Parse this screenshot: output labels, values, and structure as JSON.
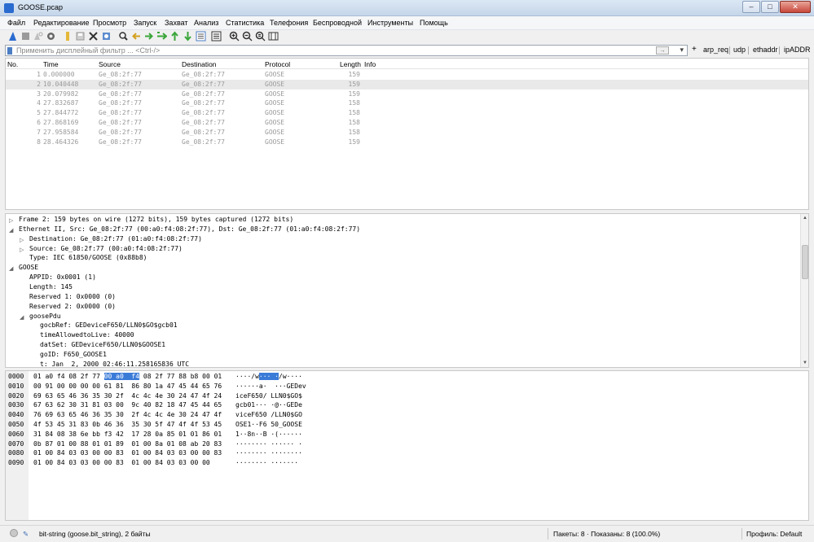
{
  "window": {
    "title": "GOOSE.pcap",
    "min": "–",
    "max": "□",
    "close": "✕"
  },
  "menu": [
    "Файл",
    "Редактирование",
    "Просмотр",
    "Запуск",
    "Захват",
    "Анализ",
    "Статистика",
    "Телефония",
    "Беспроводной",
    "Инструменты",
    "Помощь"
  ],
  "toolbar_icons": [
    "shark-fin-start-icon",
    "stop-icon",
    "restart-icon",
    "options-gear-icon",
    "open-folder-icon",
    "save-icon",
    "close-file-icon",
    "reload-icon",
    "find-icon",
    "back-arrow-icon",
    "forward-arrow-icon",
    "go-to-packet-icon",
    "first-packet-icon",
    "last-packet-icon",
    "autoscroll-icon",
    "colorize-icon",
    "zoom-in-icon",
    "zoom-out-icon",
    "zoom-normal-icon",
    "resize-columns-icon"
  ],
  "filter": {
    "placeholder": "Применить дисплейный фильтр ... <Ctrl-/>",
    "arrow": "→",
    "dropdown": "▾",
    "apply": "→",
    "plus": "+",
    "buttons": [
      "arp_req",
      "udp",
      "ethaddr",
      "ipADDR"
    ]
  },
  "packet_list": {
    "columns": [
      "No.",
      "Time",
      "Source",
      "Destination",
      "Protocol",
      "Length",
      "Info"
    ],
    "rows": [
      {
        "no": "1",
        "time": "0.000000",
        "src": "Ge_08:2f:77",
        "dst": "Ge_08:2f:77",
        "proto": "GOOSE",
        "len": "159"
      },
      {
        "no": "2",
        "time": "10.040448",
        "src": "Ge_08:2f:77",
        "dst": "Ge_08:2f:77",
        "proto": "GOOSE",
        "len": "159"
      },
      {
        "no": "3",
        "time": "20.079982",
        "src": "Ge_08:2f:77",
        "dst": "Ge_08:2f:77",
        "proto": "GOOSE",
        "len": "159"
      },
      {
        "no": "4",
        "time": "27.832687",
        "src": "Ge_08:2f:77",
        "dst": "Ge_08:2f:77",
        "proto": "GOOSE",
        "len": "158"
      },
      {
        "no": "5",
        "time": "27.844772",
        "src": "Ge_08:2f:77",
        "dst": "Ge_08:2f:77",
        "proto": "GOOSE",
        "len": "158"
      },
      {
        "no": "6",
        "time": "27.868169",
        "src": "Ge_08:2f:77",
        "dst": "Ge_08:2f:77",
        "proto": "GOOSE",
        "len": "158"
      },
      {
        "no": "7",
        "time": "27.958584",
        "src": "Ge_08:2f:77",
        "dst": "Ge_08:2f:77",
        "proto": "GOOSE",
        "len": "158"
      },
      {
        "no": "8",
        "time": "28.464326",
        "src": "Ge_08:2f:77",
        "dst": "Ge_08:2f:77",
        "proto": "GOOSE",
        "len": "159"
      }
    ]
  },
  "details": [
    {
      "text": "Frame 2: 159 bytes on wire (1272 bits), 159 bytes captured (1272 bits)",
      "tri": "▷"
    },
    {
      "text": "Ethernet II, Src: Ge_08:2f:77 (00:a0:f4:08:2f:77), Dst: Ge_08:2f:77 (01:a0:f4:08:2f:77)",
      "tri": "◢"
    },
    {
      "text": "Destination: Ge_08:2f:77 (01:a0:f4:08:2f:77)",
      "tri": "▷"
    },
    {
      "text": "Source: Ge_08:2f:77 (00:a0:f4:08:2f:77)",
      "tri": "▷"
    },
    {
      "text": "Type: IEC 61850/GOOSE (0x88b8)",
      "tri": ""
    },
    {
      "text": "GOOSE",
      "tri": "◢"
    },
    {
      "text": "APPID: 0x0001 (1)",
      "tri": ""
    },
    {
      "text": "Length: 145",
      "tri": ""
    },
    {
      "text": "Reserved 1: 0x0000 (0)",
      "tri": ""
    },
    {
      "text": "Reserved 2: 0x0000 (0)",
      "tri": ""
    },
    {
      "text": "goosePdu",
      "tri": "◢"
    },
    {
      "text": "gocbRef: GEDeviceF650/LLN0$GO$gcb01",
      "tri": ""
    },
    {
      "text": "timeAllowedtoLive: 40000",
      "tri": ""
    },
    {
      "text": "datSet: GEDeviceF650/LLN0$GOOSE1",
      "tri": ""
    },
    {
      "text": "goID: F650_GOOSE1",
      "tri": ""
    },
    {
      "text": "t: Jan  2, 2000 02:46:11.258165836 UTC",
      "tri": ""
    }
  ],
  "hex": [
    {
      "off": "0000",
      "h1": "01 a0 f4 08 2f 77",
      "hl": "00 a0  f4",
      "h2": "08 2f 77 88 b8 00 01",
      "a1": "····/w",
      "ahl": "··· ·",
      "a2": "/w····"
    },
    {
      "off": "0010",
      "h1": "00 91 00 00 00 00 61 81  86 80 1a 47 45 44 65 76",
      "hl": "",
      "h2": "",
      "a1": "······a·  ···GEDev",
      "ahl": "",
      "a2": ""
    },
    {
      "off": "0020",
      "h1": "69 63 65 46 36 35 30 2f  4c 4c 4e 30 24 47 4f 24",
      "hl": "",
      "h2": "",
      "a1": "iceF650/ LLN0$GO$",
      "ahl": "",
      "a2": ""
    },
    {
      "off": "0030",
      "h1": "67 63 62 30 31 81 03 00  9c 40 82 18 47 45 44 65",
      "hl": "",
      "h2": "",
      "a1": "gcb01··· ·@··GEDe",
      "ahl": "",
      "a2": ""
    },
    {
      "off": "0040",
      "h1": "76 69 63 65 46 36 35 30  2f 4c 4c 4e 30 24 47 4f",
      "hl": "",
      "h2": "",
      "a1": "viceF650 /LLN0$GO",
      "ahl": "",
      "a2": ""
    },
    {
      "off": "0050",
      "h1": "4f 53 45 31 83 0b 46 36  35 30 5f 47 4f 4f 53 45",
      "hl": "",
      "h2": "",
      "a1": "OSE1··F6 50_GOOSE",
      "ahl": "",
      "a2": ""
    },
    {
      "off": "0060",
      "h1": "31 84 08 38 6e bb f3 42  17 28 0a 85 01 01 86 01",
      "hl": "",
      "h2": "",
      "a1": "1··8n··B ·(······",
      "ahl": "",
      "a2": ""
    },
    {
      "off": "0070",
      "h1": "0b 87 01 00 88 01 01 89  01 00 8a 01 08 ab 20 83",
      "hl": "",
      "h2": "",
      "a1": "········ ······ ·",
      "ahl": "",
      "a2": ""
    },
    {
      "off": "0080",
      "h1": "01 00 84 03 03 00 00 83  01 00 84 03 03 00 00 83",
      "hl": "",
      "h2": "",
      "a1": "········ ········",
      "ahl": "",
      "a2": ""
    },
    {
      "off": "0090",
      "h1": "01 00 84 03 03 00 00 83  01 00 84 03 03 00 00",
      "hl": "",
      "h2": "",
      "a1": "········ ·······",
      "ahl": "",
      "a2": ""
    }
  ],
  "status": {
    "field": "bit-string (goose.bit_string), 2 байты",
    "packets": "Пакеты: 8 · Показаны: 8 (100.0%)",
    "profile": "Профиль: Default"
  },
  "colors": {
    "highlight": "#3b7bd8",
    "muted_text": "#9a9a9a",
    "ok_green": "#3aa63a"
  }
}
